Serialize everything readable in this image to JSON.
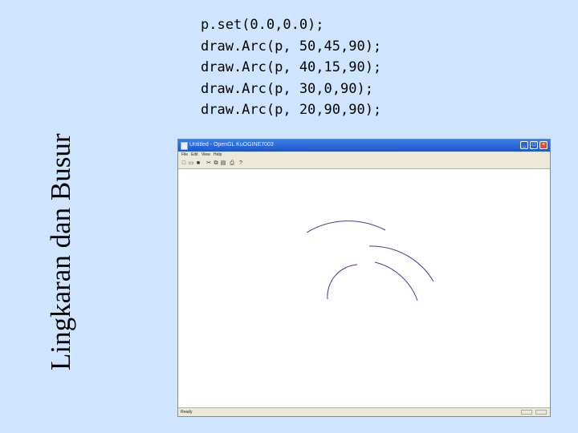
{
  "slide": {
    "side_title": "Lingkaran dan Busur",
    "code_lines": [
      "p.set(0.0,0.0);",
      "draw.Arc(p, 50,45,90);",
      "draw.Arc(p, 40,15,90);",
      "draw.Arc(p, 30,0,90);",
      "draw.Arc(p, 20,90,90);"
    ]
  },
  "window": {
    "title": "Untitled - OpenGL KuOGINE7003",
    "menu": [
      "File",
      "Edit",
      "View",
      "Help"
    ],
    "toolbar_icons": [
      "new-icon",
      "open-icon",
      "save-icon",
      "cut-icon",
      "copy-icon",
      "paste-icon",
      "print-icon",
      "help-icon"
    ],
    "toolbar_glyphs": [
      "□",
      "▭",
      "■",
      "✂",
      "⧉",
      "▤",
      "⎙",
      "?"
    ],
    "status": "Ready",
    "titlebar_color": "#2a66d9",
    "arc_color": "#3b3f9a"
  }
}
